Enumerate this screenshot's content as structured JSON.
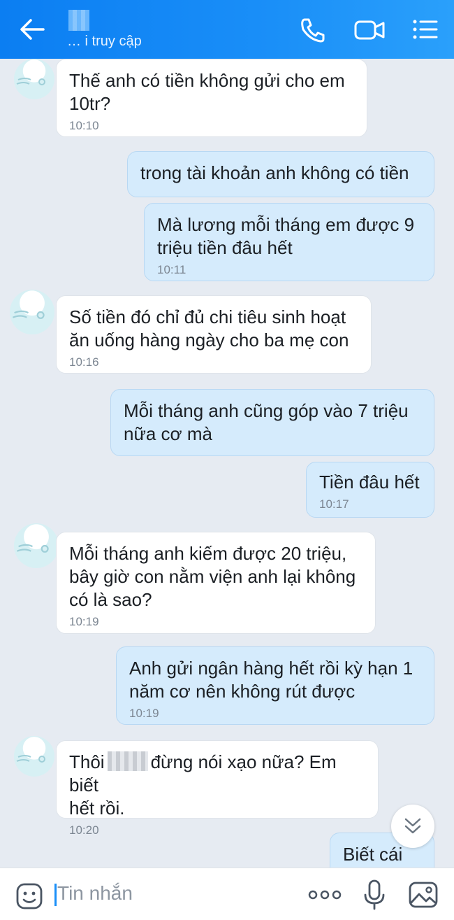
{
  "header": {
    "status": "… i truy cập"
  },
  "messages": [
    {
      "side": "in",
      "text": "Thế anh có tiền không gửi cho em\n10tr?",
      "time": "10:10"
    },
    {
      "side": "out",
      "text": "trong tài khoản anh không có tiền",
      "time": ""
    },
    {
      "side": "out",
      "text": "Mà lương mỗi tháng em được 9\ntriệu tiền đâu hết",
      "time": "10:11"
    },
    {
      "side": "in",
      "text": "Số tiền đó chỉ đủ chi tiêu sinh hoạt\năn uống hàng ngày cho ba mẹ con",
      "time": "10:16"
    },
    {
      "side": "out",
      "text": "Mỗi tháng anh cũng góp vào 7 triệu\nnữa cơ mà",
      "time": ""
    },
    {
      "side": "out",
      "text": "Tiền đâu hết",
      "time": "10:17"
    },
    {
      "side": "in",
      "text": "Mỗi tháng anh kiếm được 20 triệu,\nbây giờ con nằm viện anh lại không\ncó là sao?",
      "time": "10:19"
    },
    {
      "side": "out",
      "text": "Anh gửi ngân hàng hết rồi kỳ hạn 1\nnăm cơ nên không rút được",
      "time": "10:19"
    },
    {
      "side": "in",
      "text_before": "Thôi",
      "text_after": "đừng nói xạo nữa? Em biết\nhết rồi.",
      "time": "10:20"
    },
    {
      "side": "out",
      "text": "Biết cái gì",
      "time": ""
    }
  ],
  "composer": {
    "placeholder": "Tin nhắn"
  },
  "icons": {
    "back": "arrow-left-icon",
    "call": "phone-icon",
    "video": "video-camera-icon",
    "menu": "list-menu-icon",
    "emoji": "emoji-icon",
    "more": "more-dots-icon",
    "mic": "microphone-icon",
    "image": "image-icon",
    "scroll": "double-chevron-down-icon"
  },
  "colors": {
    "header": "#1a8ff8",
    "background": "#e6ebf2",
    "incoming_bubble": "#ffffff",
    "outgoing_bubble": "#d5ebfc"
  }
}
